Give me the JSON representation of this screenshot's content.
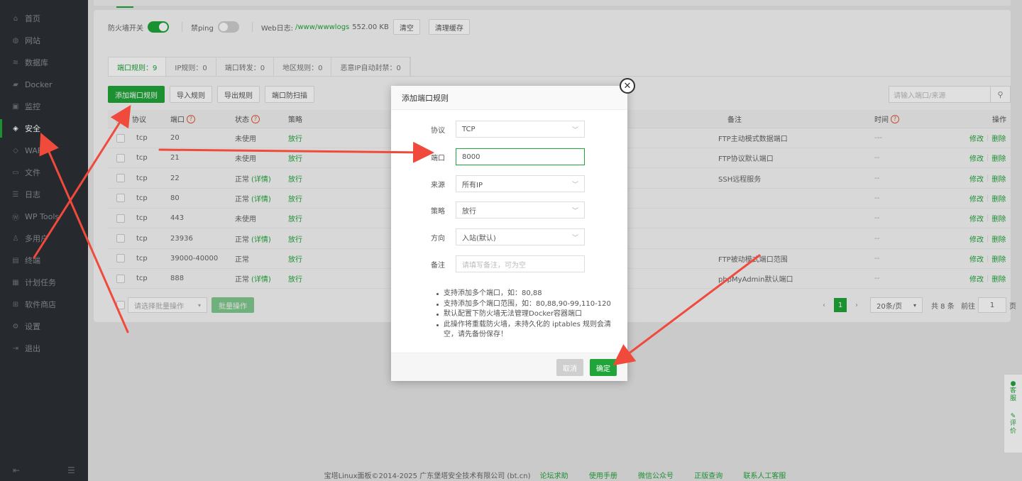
{
  "sidebar": {
    "items": [
      {
        "label": "首页",
        "icon": "home-icon"
      },
      {
        "label": "网站",
        "icon": "globe-icon"
      },
      {
        "label": "数据库",
        "icon": "database-icon"
      },
      {
        "label": "Docker",
        "icon": "docker-icon"
      },
      {
        "label": "监控",
        "icon": "monitor-icon"
      },
      {
        "label": "安全",
        "icon": "shield-icon",
        "active": true
      },
      {
        "label": "WAF",
        "icon": "waf-icon"
      },
      {
        "label": "文件",
        "icon": "folder-icon"
      },
      {
        "label": "日志",
        "icon": "log-icon"
      },
      {
        "label": "WP Tools",
        "icon": "wordpress-icon"
      },
      {
        "label": "多用户",
        "icon": "users-icon"
      },
      {
        "label": "终端",
        "icon": "terminal-icon"
      },
      {
        "label": "计划任务",
        "icon": "calendar-icon"
      },
      {
        "label": "软件商店",
        "icon": "apps-icon"
      },
      {
        "label": "设置",
        "icon": "gear-icon"
      },
      {
        "label": "退出",
        "icon": "logout-icon"
      }
    ]
  },
  "toolbar": {
    "firewall_label": "防火墙开关",
    "ping_label": "禁ping",
    "weblog_label": "Web日志:",
    "weblog_path": "/www/wwwlogs",
    "weblog_size": "552.00 KB",
    "clear_label": "清空",
    "clean_cache_label": "清理缓存"
  },
  "subtabs": [
    "端口规则：9",
    "IP规则：0",
    "端口转发：0",
    "地区规则：0",
    "恶意IP自动封禁：0"
  ],
  "actions": {
    "add_port": "添加端口规则",
    "import": "导入规则",
    "export": "导出规则",
    "scan": "端口防扫描",
    "search_placeholder": "请输入端口/来源"
  },
  "table": {
    "headers": {
      "protocol": "协议",
      "port": "端口",
      "status": "状态",
      "strategy": "策略",
      "remark": "备注",
      "time": "时间",
      "ops": "操作"
    },
    "rows": [
      {
        "protocol": "tcp",
        "port": "20",
        "status": "未使用",
        "detail": "",
        "strategy": "放行",
        "remark": "FTP主动模式数据端口",
        "time": "---"
      },
      {
        "protocol": "tcp",
        "port": "21",
        "status": "未使用",
        "detail": "",
        "strategy": "放行",
        "remark": "FTP协议默认端口",
        "time": "--"
      },
      {
        "protocol": "tcp",
        "port": "22",
        "status": "正常",
        "detail": "(详情)",
        "strategy": "放行",
        "remark": "SSH远程服务",
        "time": "--"
      },
      {
        "protocol": "tcp",
        "port": "80",
        "status": "正常",
        "detail": "(详情)",
        "strategy": "放行",
        "remark": "",
        "time": "--"
      },
      {
        "protocol": "tcp",
        "port": "443",
        "status": "未使用",
        "detail": "",
        "strategy": "放行",
        "remark": "",
        "time": "--"
      },
      {
        "protocol": "tcp",
        "port": "23936",
        "status": "正常",
        "detail": "(详情)",
        "strategy": "放行",
        "remark": "",
        "time": "--"
      },
      {
        "protocol": "tcp",
        "port": "39000-40000",
        "status": "正常",
        "detail": "",
        "strategy": "放行",
        "remark": "FTP被动模式端口范围",
        "time": "--"
      },
      {
        "protocol": "tcp",
        "port": "888",
        "status": "正常",
        "detail": "(详情)",
        "strategy": "放行",
        "remark": "phpMyAdmin默认端口",
        "time": "--"
      }
    ],
    "edit_label": "修改",
    "delete_label": "删除"
  },
  "batch": {
    "select_placeholder": "请选择批量操作",
    "button": "批量操作"
  },
  "pagination": {
    "current": "1",
    "page_size": "20条/页",
    "total": "共 8 条",
    "goto_label": "前往",
    "goto_value": "1",
    "page_unit": "页"
  },
  "footer": {
    "copyright": "宝塔Linux面板©2014-2025 广东堡塔安全技术有限公司 (bt.cn)",
    "links": [
      "论坛求助",
      "使用手册",
      "微信公众号",
      "正版查询",
      "联系人工客服"
    ]
  },
  "float_bar": {
    "service": "客服",
    "review": "评价"
  },
  "modal": {
    "title": "添加端口规则",
    "protocol_label": "协议",
    "protocol_value": "TCP",
    "port_label": "端口",
    "port_value": "8000",
    "source_label": "来源",
    "source_value": "所有IP",
    "strategy_label": "策略",
    "strategy_value": "放行",
    "direction_label": "方向",
    "direction_value": "入站(默认)",
    "remark_label": "备注",
    "remark_placeholder": "请填写备注，可为空",
    "tips": [
      "支持添加多个端口，如：80,88",
      "支持添加多个端口范围，如：80,88,90-99,110-120",
      "默认配置下防火墙无法管理Docker容器端口",
      "此操作将重载防火墙，未持久化的 iptables 规则会清空，请先备份保存！"
    ],
    "cancel": "取消",
    "confirm": "确定"
  },
  "colors": {
    "accent": "#20a53a",
    "sidebar_bg": "#2c3035",
    "arrow": "#f04a3c"
  }
}
